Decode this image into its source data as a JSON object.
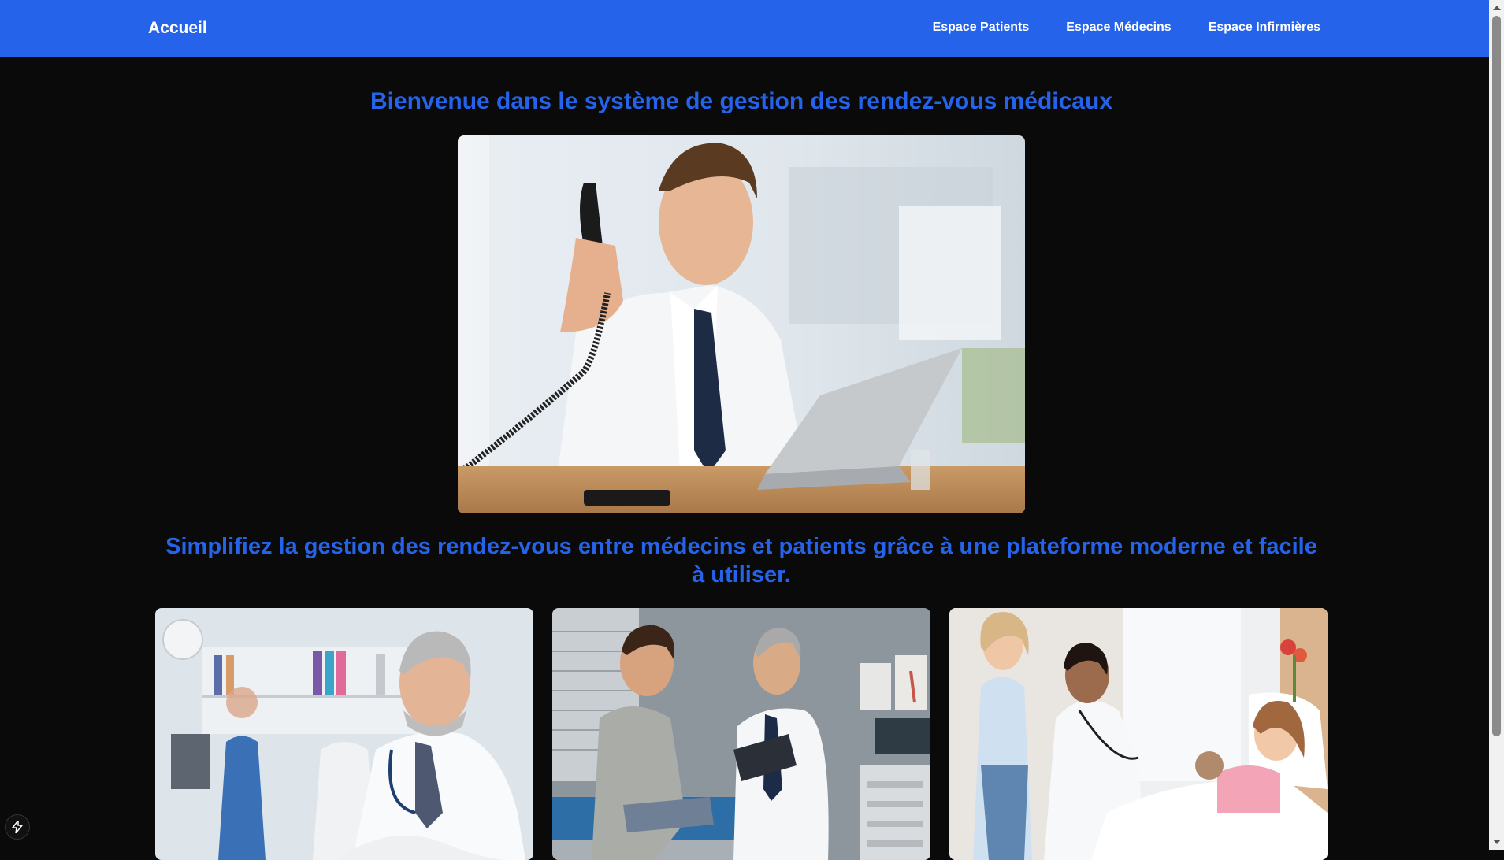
{
  "nav": {
    "home_label": "Accueil",
    "links": [
      {
        "label": "Espace Patients"
      },
      {
        "label": "Espace Médecins"
      },
      {
        "label": "Espace Infirmières"
      }
    ]
  },
  "main": {
    "title": "Bienvenue dans le système de gestion des rendez-vous médicaux",
    "subtitle": "Simplifiez la gestion des rendez-vous entre médecins et patients grâce à une plateforme moderne et facile à utiliser."
  },
  "images": {
    "hero": "doctor-on-phone-with-laptop-photo",
    "card1": "smiling-doctor-with-stethoscope-photo",
    "card2": "doctor-consulting-patient-photo",
    "card3": "nurse-examining-child-photo"
  },
  "colors": {
    "primary": "#2563eb",
    "background": "#0a0a0b",
    "nav_text": "#ffffff"
  },
  "icons": {
    "devtools": "lightning-icon"
  }
}
